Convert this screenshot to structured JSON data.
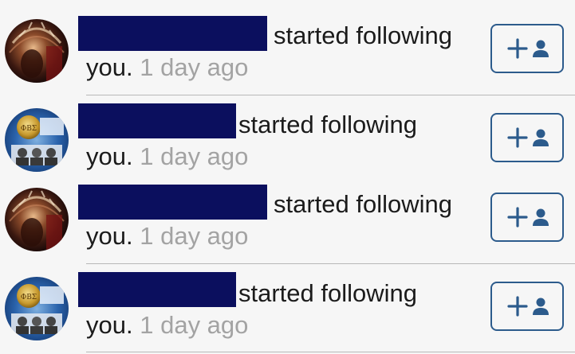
{
  "notifications": [
    {
      "avatar": "tribal-headdress-avatar",
      "action_text": "started following",
      "you_text": "you.",
      "time_text": "1 day ago",
      "follow_icon": "plus-person-icon"
    },
    {
      "avatar": "fraternity-seal-avatar",
      "action_text": "started following",
      "you_text": "you.",
      "time_text": "1 day ago",
      "follow_icon": "plus-person-icon"
    },
    {
      "avatar": "tribal-headdress-avatar",
      "action_text": "started following",
      "you_text": "you.",
      "time_text": "1 day ago",
      "follow_icon": "plus-person-icon"
    },
    {
      "avatar": "fraternity-seal-avatar",
      "action_text": "started following",
      "you_text": "you.",
      "time_text": "1 day ago",
      "follow_icon": "plus-person-icon"
    }
  ],
  "colors": {
    "redaction": "#0b0f5e",
    "button_border": "#2c5b8c",
    "timestamp": "#a3a3a3",
    "text": "#1b1b1b"
  }
}
